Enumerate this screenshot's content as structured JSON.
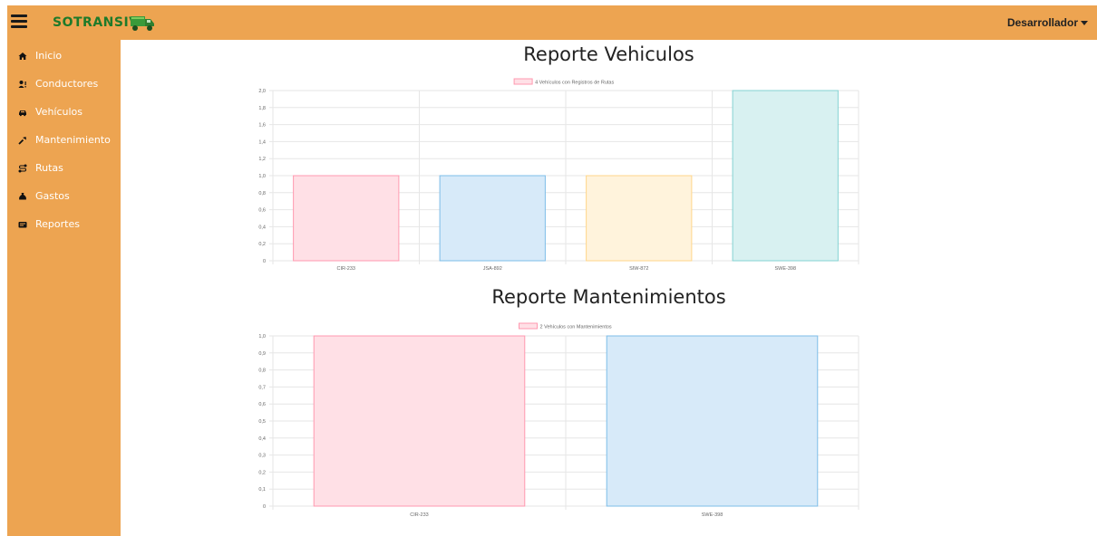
{
  "header": {
    "brand": "SOTRANSIV",
    "user_menu": "Desarrollador"
  },
  "sidebar": {
    "items": [
      {
        "label": "Inicio",
        "icon": "home-icon"
      },
      {
        "label": "Conductores",
        "icon": "users-icon"
      },
      {
        "label": "Vehículos",
        "icon": "car-icon"
      },
      {
        "label": "Mantenimiento",
        "icon": "wrench-icon"
      },
      {
        "label": "Rutas",
        "icon": "route-icon"
      },
      {
        "label": "Gastos",
        "icon": "money-bag-icon"
      },
      {
        "label": "Reportes",
        "icon": "report-icon"
      }
    ]
  },
  "colors": {
    "sidebar": "#eda451",
    "brand_text": "#1e7a2a",
    "pink_fill": "#ffe0e6",
    "pink_stroke": "#ff99b0",
    "blue_fill": "#d7eaf9",
    "blue_stroke": "#7dbde8",
    "yellow_fill": "#fff3dc",
    "yellow_stroke": "#ffd68a",
    "teal_fill": "#d8f1f1",
    "teal_stroke": "#85d3d3"
  },
  "reports": {
    "vehicles_title": "Reporte Vehiculos",
    "maintenance_title": "Reporte Mantenimientos"
  },
  "chart_data": [
    {
      "type": "bar",
      "title": "Reporte Vehiculos",
      "legend": "4 Vehículos con Registros de Rutas",
      "categories": [
        "CIR-233",
        "JSA-892",
        "SIW-872",
        "SWE-398"
      ],
      "values": [
        1,
        1,
        1,
        2
      ],
      "ylim": [
        0,
        2
      ],
      "yticks": [
        "2,0",
        "1,8",
        "1,6",
        "1,4",
        "1,2",
        "1,0",
        "0,8",
        "0,6",
        "0,4",
        "0,2",
        "0"
      ],
      "bar_colors": [
        "pink",
        "blue",
        "yellow",
        "teal"
      ],
      "grid": true,
      "legend_position": "top"
    },
    {
      "type": "bar",
      "title": "Reporte Mantenimientos",
      "legend": "2 Vehículos con Mantenimientos",
      "categories": [
        "CIR-233",
        "SWE-398"
      ],
      "values": [
        1,
        1
      ],
      "ylim": [
        0,
        1
      ],
      "yticks": [
        "1,0",
        "0,9",
        "0,8",
        "0,7",
        "0,6",
        "0,5",
        "0,4",
        "0,3",
        "0,2",
        "0,1",
        "0"
      ],
      "bar_colors": [
        "pink",
        "blue"
      ],
      "grid": true,
      "legend_position": "top"
    }
  ]
}
